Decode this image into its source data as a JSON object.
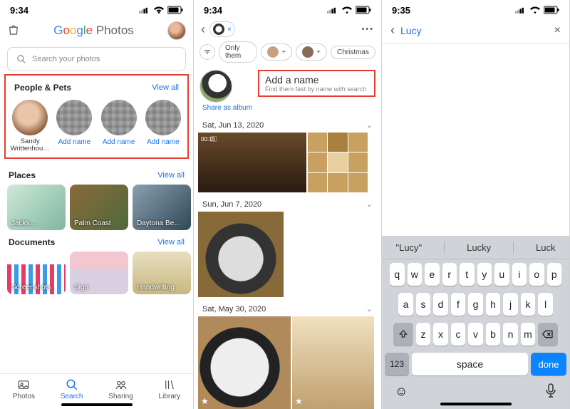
{
  "status": {
    "time_left": "9:34",
    "time_mid": "9:34",
    "time_right": "9:35"
  },
  "panel1": {
    "logo_photos": "Photos",
    "search_placeholder": "Search your photos",
    "people_pets": {
      "title": "People & Pets",
      "view_all": "View all",
      "items": [
        {
          "name": "Sandy Writtenhou…"
        },
        {
          "name": "Add name"
        },
        {
          "name": "Add name"
        },
        {
          "name": "Add name"
        }
      ]
    },
    "places": {
      "title": "Places",
      "view_all": "View all",
      "items": [
        "Jacks…",
        "Palm Coast",
        "Daytona Be…"
      ]
    },
    "documents": {
      "title": "Documents",
      "view_all": "View all",
      "items": [
        "Screenshots",
        "Sign",
        "Handwriting"
      ]
    },
    "tabs": {
      "photos": "Photos",
      "search": "Search",
      "sharing": "Sharing",
      "library": "Library"
    }
  },
  "panel2": {
    "chips": {
      "only_them": "Only them",
      "christmas": "Christmas"
    },
    "name_block": {
      "title": "Add a name",
      "subtitle": "Find them fast by name with search"
    },
    "share": "Share as album",
    "dates": [
      "Sat, Jun 13, 2020",
      "Sun, Jun 7, 2020",
      "Sat, May 30, 2020"
    ],
    "video_duration": "00:15"
  },
  "panel3": {
    "input_value": "Lucy",
    "suggestions": [
      "\"Lucy\"",
      "Lucky",
      "Luck"
    ],
    "rows": [
      [
        "q",
        "w",
        "e",
        "r",
        "t",
        "y",
        "u",
        "i",
        "o",
        "p"
      ],
      [
        "a",
        "s",
        "d",
        "f",
        "g",
        "h",
        "j",
        "k",
        "l"
      ],
      [
        "z",
        "x",
        "c",
        "v",
        "b",
        "n",
        "m"
      ]
    ],
    "keys": {
      "num": "123",
      "space": "space",
      "done": "done"
    }
  }
}
